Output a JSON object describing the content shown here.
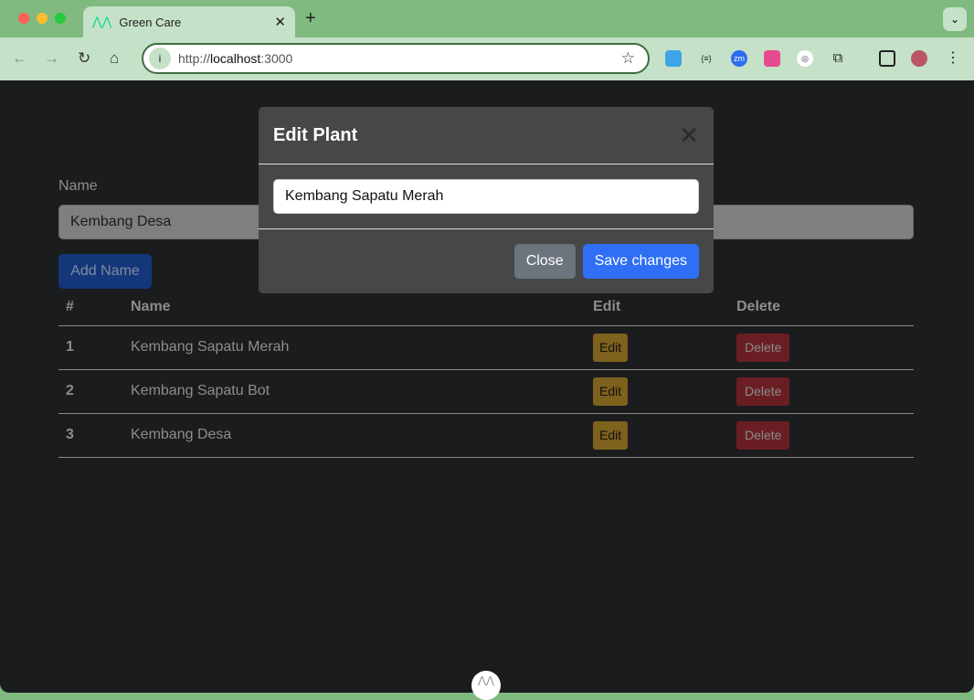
{
  "browser": {
    "tab_title": "Green Care",
    "url_scheme": "http://",
    "url_host": "localhost",
    "url_port": ":3000"
  },
  "form": {
    "label": "Name",
    "value": "Kembang Desa",
    "add_button": "Add Name"
  },
  "table": {
    "headers": [
      "#",
      "Name",
      "Edit",
      "Delete"
    ],
    "rows": [
      {
        "id": "1",
        "name": "Kembang Sapatu Merah",
        "edit": "Edit",
        "delete": "Delete"
      },
      {
        "id": "2",
        "name": "Kembang Sapatu Bot",
        "edit": "Edit",
        "delete": "Delete"
      },
      {
        "id": "3",
        "name": "Kembang Desa",
        "edit": "Edit",
        "delete": "Delete"
      }
    ]
  },
  "modal": {
    "title": "Edit Plant",
    "input_value": "Kembang Sapatu Merah",
    "close_label": "Close",
    "save_label": "Save changes"
  },
  "colors": {
    "accent": "#2f6ff5",
    "page_bg": "#1b1c1e",
    "chrome": "#c5e1c8"
  }
}
